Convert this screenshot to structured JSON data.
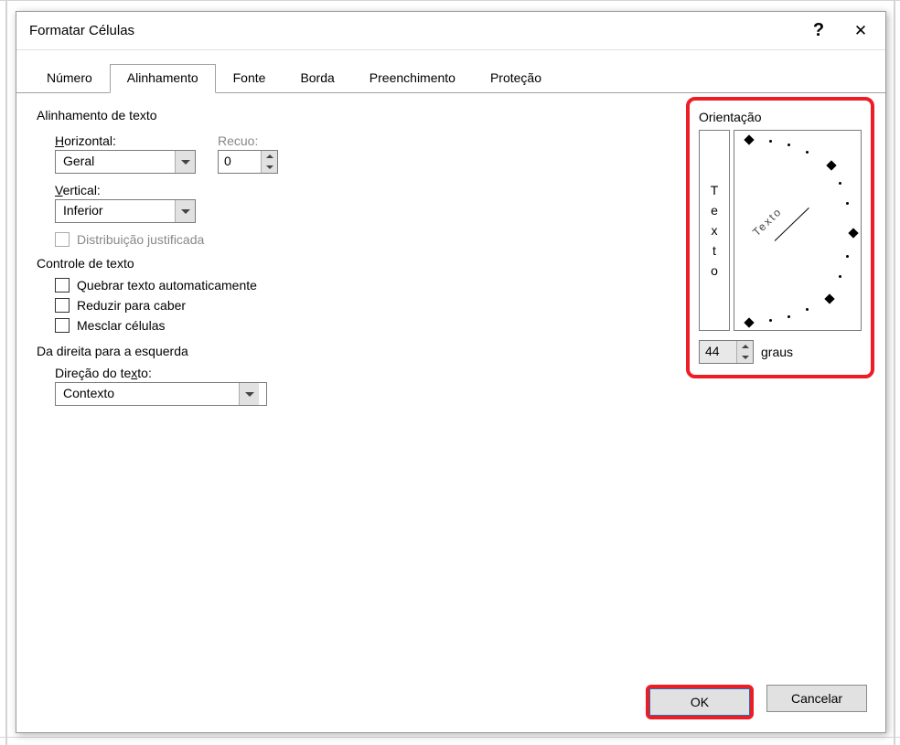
{
  "dialog": {
    "title": "Formatar Células"
  },
  "tabs": {
    "items": [
      {
        "label": "Número"
      },
      {
        "label": "Alinhamento"
      },
      {
        "label": "Fonte"
      },
      {
        "label": "Borda"
      },
      {
        "label": "Preenchimento"
      },
      {
        "label": "Proteção"
      }
    ],
    "active_index": 1
  },
  "alignment": {
    "section_label": "Alinhamento de texto",
    "horizontal_label": "Horizontal:",
    "horizontal_value": "Geral",
    "vertical_label": "Vertical:",
    "vertical_value": "Inferior",
    "recuo_label": "Recuo:",
    "recuo_value": "0",
    "justify_distributed_label": "Distribuição justificada"
  },
  "text_control": {
    "section_label": "Controle de texto",
    "wrap_label": "Quebrar texto automaticamente",
    "shrink_label": "Reduzir para caber",
    "merge_label": "Mesclar células"
  },
  "rtl": {
    "section_label": "Da direita para a esquerda",
    "direction_label": "Direção do texto:",
    "direction_value": "Contexto"
  },
  "orientation": {
    "section_label": "Orientação",
    "vertical_text": "Texto",
    "dial_text": "Texto",
    "degrees_value": "44",
    "degrees_label": "graus"
  },
  "buttons": {
    "ok": "OK",
    "cancel": "Cancelar"
  }
}
